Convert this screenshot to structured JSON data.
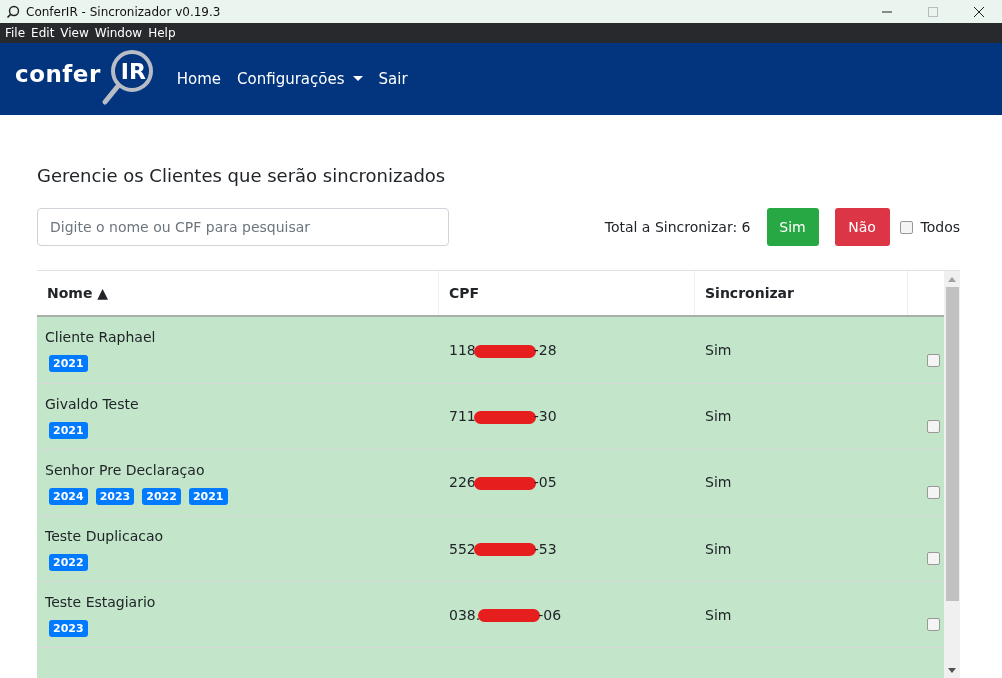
{
  "window": {
    "title": "ConferIR - Sincronizador v0.19.3"
  },
  "menu": [
    "File",
    "Edit",
    "View",
    "Window",
    "Help"
  ],
  "navbar": {
    "logo": "confer",
    "logo_mark": "IR",
    "links": [
      {
        "label": "Home",
        "kind": "link"
      },
      {
        "label": "Configurações",
        "kind": "dropdown"
      },
      {
        "label": "Sair",
        "kind": "link"
      }
    ]
  },
  "heading": "Gerencie os Clientes que serão sincronizados",
  "search": {
    "placeholder": "Digite o nome ou CPF para pesquisar"
  },
  "total": "Total a Sincronizar: 6",
  "buttons": [
    {
      "label": "Sim",
      "kind": "success"
    },
    {
      "label": "Não",
      "kind": "danger"
    }
  ],
  "select_all": {
    "label": "Todos",
    "checked": false
  },
  "table": {
    "columns": [
      "Nome ▲",
      "CPF",
      "Sincronizar"
    ],
    "rows": [
      {
        "name": "Cliente Raphael",
        "years": [
          "2021"
        ],
        "cpf_start": "118",
        "cpf_end": "-28",
        "sync": "Sim",
        "checked": false
      },
      {
        "name": "Givaldo Teste",
        "years": [
          "2021"
        ],
        "cpf_start": "711",
        "cpf_end": "-30",
        "sync": "Sim",
        "checked": false
      },
      {
        "name": "Senhor Pre Declaraçao",
        "years": [
          "2024",
          "2023",
          "2022",
          "2021"
        ],
        "cpf_start": "226",
        "cpf_end": "-05",
        "sync": "Sim",
        "checked": false
      },
      {
        "name": "Teste Duplicacao",
        "years": [
          "2022"
        ],
        "cpf_start": "552",
        "cpf_end": "-53",
        "sync": "Sim",
        "checked": false
      },
      {
        "name": "Teste Estagiario",
        "years": [
          "2023"
        ],
        "cpf_start": "038.",
        "cpf_end": "-06",
        "sync": "Sim",
        "checked": false
      }
    ]
  }
}
